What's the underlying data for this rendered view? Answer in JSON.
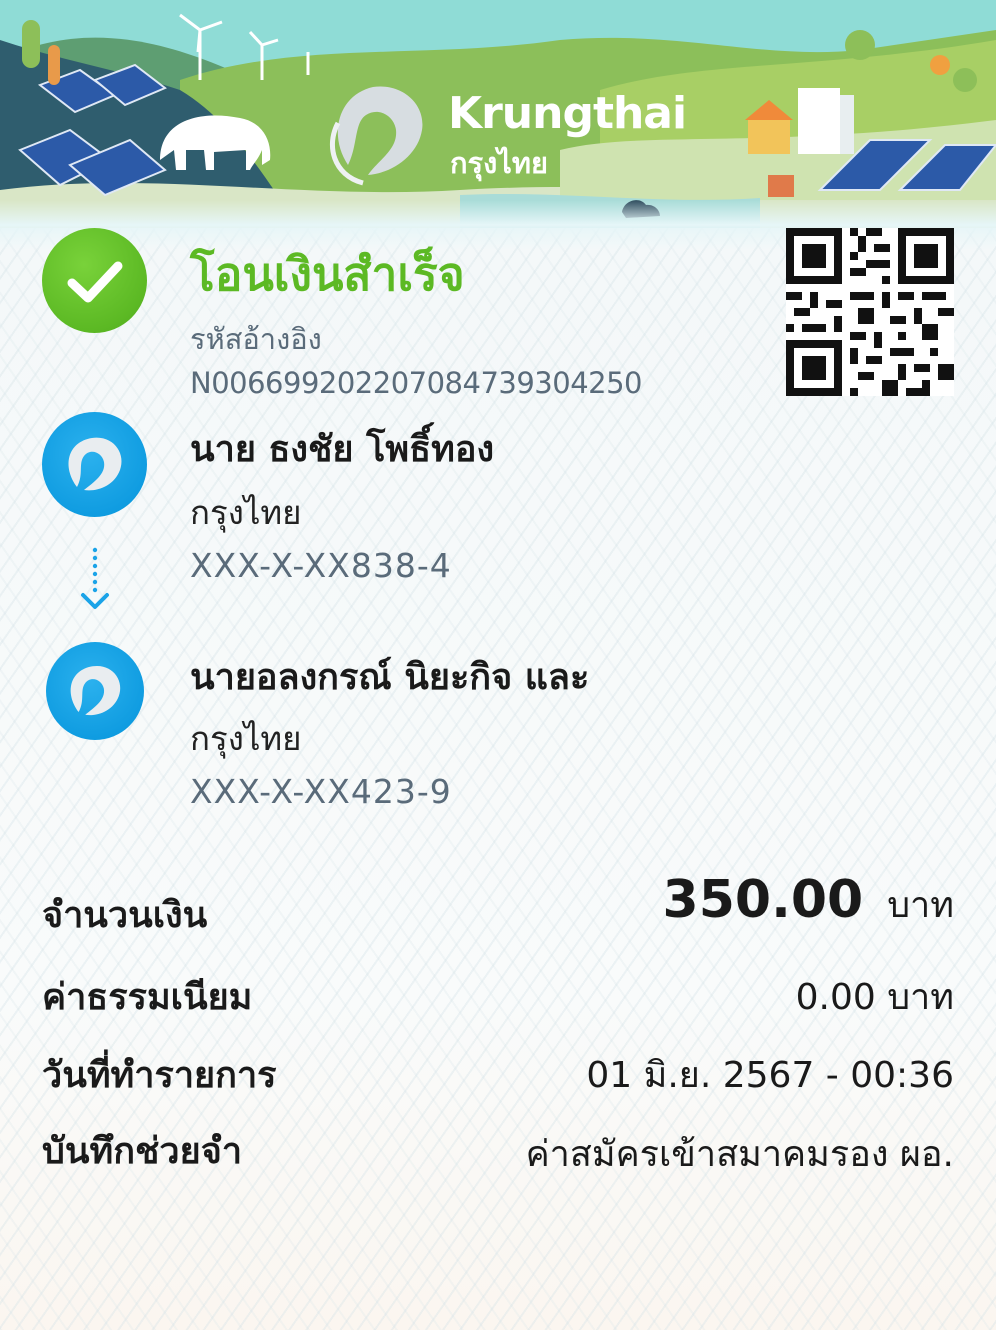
{
  "brand": {
    "name": "Krungthai",
    "name_th": "กรุงไทย",
    "colors": {
      "success": "#5cb924",
      "bank_blue": "#0e9be0",
      "muted": "#5a6b7a"
    }
  },
  "status": {
    "title": "โอนเงินสำเร็จ",
    "ref_label": "รหัสอ้างอิง",
    "ref_value": "N006699202207084739304250",
    "icon": "check-circle-icon"
  },
  "sender": {
    "name": "นาย ธงชัย โพธิ์ทอง",
    "bank": "กรุงไทย",
    "account": "XXX-X-XX838-4"
  },
  "receiver": {
    "name": "นายอลงกรณ์ นิยะกิจ และ",
    "bank": "กรุงไทย",
    "account": "XXX-X-XX423-9"
  },
  "details": {
    "amount_label": "จำนวนเงิน",
    "amount_value": "350.00",
    "amount_unit": "บาท",
    "fee_label": "ค่าธรรมเนียม",
    "fee_value": "0.00 บาท",
    "date_label": "วันที่ทำรายการ",
    "date_value": "01 มิ.ย. 2567 - 00:36",
    "memo_label": "บันทึกช่วยจำ",
    "memo_value": "ค่าสมัครเข้าสมาคมรอง ผอ."
  }
}
